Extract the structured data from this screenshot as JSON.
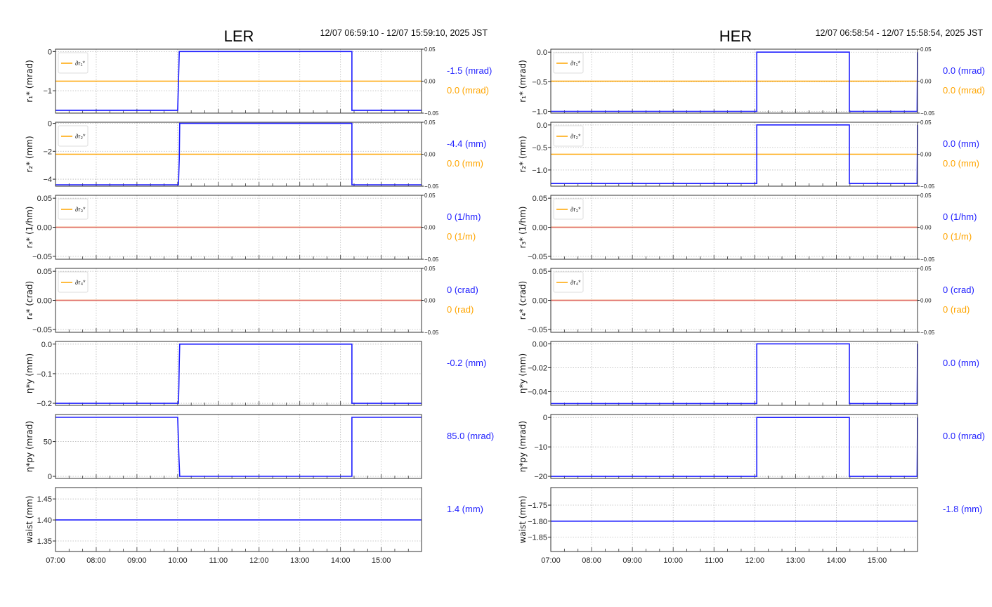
{
  "colors": {
    "main": "#1f1fff",
    "delta": "#ffa500",
    "zero_line": "#e07070",
    "grid": "#bbbbbb"
  },
  "chart_data": [
    {
      "type": "line",
      "title": "LER",
      "time_range": "12/07 06:59:10 - 12/07 15:59:10, 2025 JST",
      "xlim": [
        7.0,
        15.99
      ],
      "xticks": [
        "07:00",
        "08:00",
        "09:00",
        "10:00",
        "11:00",
        "12:00",
        "13:00",
        "14:00",
        "15:00"
      ],
      "panels": [
        {
          "ylabel": "r₁* (mrad)",
          "ylim": [
            -1.57,
            0.06
          ],
          "yticks": [
            0,
            -1
          ],
          "yticklabels": [
            "0",
            "−1"
          ],
          "series": [
            [
              7.0,
              -1.5
            ],
            [
              10.0,
              -1.5
            ],
            [
              10.02,
              -0.8
            ],
            [
              10.04,
              0
            ],
            [
              14.28,
              0
            ],
            [
              14.28,
              -1.5
            ],
            [
              15.99,
              -1.5
            ]
          ],
          "delta": {
            "legend": "∂r₁*",
            "ylim": [
              -0.05,
              0.05
            ],
            "yticklabels": [
              "0.05",
              "0.00",
              "−0.05"
            ],
            "value": 0.0
          },
          "value_label": "-1.5 (mrad)",
          "delta_label": "0.0 (mrad)"
        },
        {
          "ylabel": "r₂* (mm)",
          "ylim": [
            -4.5,
            0.08
          ],
          "yticks": [
            0,
            -2,
            -4
          ],
          "yticklabels": [
            "0",
            "−2",
            "−4"
          ],
          "series": [
            [
              7.0,
              -4.4
            ],
            [
              10.02,
              -4.4
            ],
            [
              10.04,
              -2.5
            ],
            [
              10.05,
              0
            ],
            [
              14.28,
              0
            ],
            [
              14.28,
              -4.4
            ],
            [
              15.99,
              -4.4
            ]
          ],
          "delta": {
            "legend": "∂r₂*",
            "ylim": [
              -0.05,
              0.05
            ],
            "yticklabels": [
              "0.05",
              "0.00",
              "−0.05"
            ],
            "value": 0.0
          },
          "value_label": "-4.4 (mm)",
          "delta_label": "0.0 (mm)"
        },
        {
          "ylabel": "r₃* (1/hm)",
          "ylim": [
            -0.055,
            0.055
          ],
          "yticks": [
            0.05,
            0,
            -0.05
          ],
          "yticklabels": [
            "0.05",
            "0.00",
            "−0.05"
          ],
          "series": [
            [
              7.0,
              0
            ],
            [
              15.99,
              0
            ]
          ],
          "series_color": "zero_line",
          "delta": {
            "legend": "∂r₃*",
            "ylim": [
              -0.05,
              0.05
            ],
            "yticklabels": [
              "0.05",
              "0.00",
              "−0.05"
            ],
            "value": 0.0
          },
          "value_label": "0 (1/hm)",
          "delta_label": "0 (1/m)"
        },
        {
          "ylabel": "r₄* (crad)",
          "ylim": [
            -0.055,
            0.055
          ],
          "yticks": [
            0.05,
            0,
            -0.05
          ],
          "yticklabels": [
            "0.05",
            "0.00",
            "−0.05"
          ],
          "series": [
            [
              7.0,
              0
            ],
            [
              15.99,
              0
            ]
          ],
          "series_color": "zero_line",
          "delta": {
            "legend": "∂r₄*",
            "ylim": [
              -0.05,
              0.05
            ],
            "yticklabels": [
              "0.05",
              "0.00",
              "−0.05"
            ],
            "value": 0.0
          },
          "value_label": "0 (crad)",
          "delta_label": "0 (rad)"
        },
        {
          "ylabel": "η*y (mm)",
          "ylim": [
            -0.207,
            0.009
          ],
          "yticks": [
            0,
            -0.1,
            -0.2
          ],
          "yticklabels": [
            "0.0",
            "−0.1",
            "−0.2"
          ],
          "series": [
            [
              7.0,
              -0.2
            ],
            [
              10.02,
              -0.2
            ],
            [
              10.03,
              -0.14
            ],
            [
              10.04,
              -0.06
            ],
            [
              10.05,
              0
            ],
            [
              14.28,
              0
            ],
            [
              14.28,
              -0.2
            ],
            [
              15.99,
              -0.2
            ]
          ],
          "value_label": "-0.2 (mm)"
        },
        {
          "ylabel": "η*py (mrad)",
          "ylim": [
            -3,
            89
          ],
          "yticks": [
            50,
            0
          ],
          "yticklabels": [
            "50",
            "0"
          ],
          "series": [
            [
              7.0,
              85
            ],
            [
              10.0,
              85
            ],
            [
              10.02,
              50
            ],
            [
              10.03,
              30
            ],
            [
              10.05,
              0
            ],
            [
              14.28,
              0
            ],
            [
              14.28,
              85
            ],
            [
              15.99,
              85
            ]
          ],
          "value_label": "85.0 (mrad)"
        },
        {
          "ylabel": "waist (mm)",
          "ylim": [
            1.325,
            1.477
          ],
          "yticks": [
            1.45,
            1.4,
            1.35
          ],
          "yticklabels": [
            "1.45",
            "1.40",
            "1.35"
          ],
          "series": [
            [
              7.0,
              1.4
            ],
            [
              15.99,
              1.4
            ]
          ],
          "value_label": "1.4 (mm)"
        }
      ]
    },
    {
      "type": "line",
      "title": "HER",
      "time_range": "12/07 06:58:54 - 12/07 15:58:54, 2025 JST",
      "xlim": [
        7.0,
        15.99
      ],
      "xticks": [
        "07:00",
        "08:00",
        "09:00",
        "10:00",
        "11:00",
        "12:00",
        "13:00",
        "14:00",
        "15:00"
      ],
      "panels": [
        {
          "ylabel": "r₁* (mrad)",
          "ylim": [
            -1.03,
            0.05
          ],
          "yticks": [
            0,
            -0.5,
            -1.0
          ],
          "yticklabels": [
            "0.0",
            "−0.5",
            "−1.0"
          ],
          "series": [
            [
              7.0,
              -1.0
            ],
            [
              12.05,
              -1.0
            ],
            [
              12.05,
              0
            ],
            [
              14.32,
              0
            ],
            [
              14.32,
              -1.0
            ],
            [
              15.98,
              -1.0
            ],
            [
              15.99,
              0
            ]
          ],
          "delta": {
            "legend": "∂r₁*",
            "ylim": [
              -0.05,
              0.05
            ],
            "yticklabels": [
              "0.05",
              "0.00",
              "−0.05"
            ],
            "value": 0.0
          },
          "value_label": "0.0 (mrad)",
          "delta_label": "0.0 (mrad)"
        },
        {
          "ylabel": "r₂* (mm)",
          "ylim": [
            -1.36,
            0.06
          ],
          "yticks": [
            0,
            -0.5,
            -1.0
          ],
          "yticklabels": [
            "0.0",
            "−0.5",
            "−1.0"
          ],
          "series": [
            [
              7.0,
              -1.3
            ],
            [
              12.05,
              -1.3
            ],
            [
              12.05,
              0
            ],
            [
              14.32,
              0
            ],
            [
              14.32,
              -1.3
            ],
            [
              15.98,
              -1.3
            ],
            [
              15.99,
              0
            ]
          ],
          "delta": {
            "legend": "∂r₂*",
            "ylim": [
              -0.05,
              0.05
            ],
            "yticklabels": [
              "0.05",
              "0.00",
              "−0.05"
            ],
            "value": 0.0
          },
          "value_label": "0.0 (mm)",
          "delta_label": "0.0 (mm)"
        },
        {
          "ylabel": "r₃* (1/hm)",
          "ylim": [
            -0.055,
            0.055
          ],
          "yticks": [
            0.05,
            0,
            -0.05
          ],
          "yticklabels": [
            "0.05",
            "0.00",
            "−0.05"
          ],
          "series": [
            [
              7.0,
              0
            ],
            [
              15.99,
              0
            ]
          ],
          "series_color": "zero_line",
          "delta": {
            "legend": "∂r₃*",
            "ylim": [
              -0.05,
              0.05
            ],
            "yticklabels": [
              "0.05",
              "0.00",
              "−0.05"
            ],
            "value": 0.0
          },
          "value_label": "0 (1/hm)",
          "delta_label": "0 (1/m)"
        },
        {
          "ylabel": "r₄* (crad)",
          "ylim": [
            -0.055,
            0.055
          ],
          "yticks": [
            0.05,
            0,
            -0.05
          ],
          "yticklabels": [
            "0.05",
            "0.00",
            "−0.05"
          ],
          "series": [
            [
              7.0,
              0
            ],
            [
              15.99,
              0
            ]
          ],
          "series_color": "zero_line",
          "delta": {
            "legend": "∂r₄*",
            "ylim": [
              -0.05,
              0.05
            ],
            "yticklabels": [
              "0.05",
              "0.00",
              "−0.05"
            ],
            "value": 0.0
          },
          "value_label": "0 (crad)",
          "delta_label": "0 (rad)"
        },
        {
          "ylabel": "η*y (mm)",
          "ylim": [
            -0.0515,
            0.002
          ],
          "yticks": [
            0,
            -0.02,
            -0.04
          ],
          "yticklabels": [
            "0.00",
            "−0.02",
            "−0.04"
          ],
          "series": [
            [
              7.0,
              -0.05
            ],
            [
              12.05,
              -0.05
            ],
            [
              12.05,
              0
            ],
            [
              14.32,
              0
            ],
            [
              14.32,
              -0.05
            ],
            [
              15.98,
              -0.05
            ],
            [
              15.99,
              0
            ]
          ],
          "value_label": "0.0 (mm)"
        },
        {
          "ylabel": "η*py (mrad)",
          "ylim": [
            -20.7,
            1
          ],
          "yticks": [
            0,
            -10,
            -20
          ],
          "yticklabels": [
            "0",
            "−10",
            "−20"
          ],
          "series": [
            [
              7.0,
              -20
            ],
            [
              12.05,
              -20
            ],
            [
              12.05,
              0
            ],
            [
              14.32,
              0
            ],
            [
              14.32,
              -20
            ],
            [
              15.98,
              -20
            ],
            [
              15.99,
              0
            ]
          ],
          "value_label": "0.0 (mrad)"
        },
        {
          "ylabel": "waist (mm)",
          "ylim": [
            -1.895,
            -1.695
          ],
          "yticks": [
            -1.75,
            -1.8,
            -1.85
          ],
          "yticklabels": [
            "−1.75",
            "−1.80",
            "−1.85"
          ],
          "series": [
            [
              7.0,
              -1.8
            ],
            [
              15.99,
              -1.8
            ]
          ],
          "value_label": "-1.8 (mm)"
        }
      ]
    }
  ]
}
